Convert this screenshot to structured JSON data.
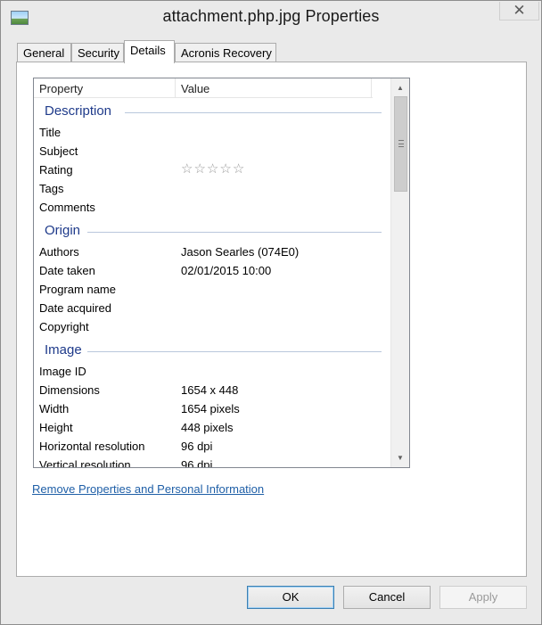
{
  "window": {
    "title": "attachment.php.jpg Properties",
    "close_glyph": "✕"
  },
  "tabs": [
    {
      "label": "General"
    },
    {
      "label": "Security"
    },
    {
      "label": "Details"
    },
    {
      "label": "Acronis Recovery"
    }
  ],
  "active_tab": "Details",
  "list": {
    "columns": {
      "property": "Property",
      "value": "Value"
    },
    "groups": {
      "description": {
        "label": "Description",
        "rows": [
          {
            "prop": "Title",
            "val": ""
          },
          {
            "prop": "Subject",
            "val": ""
          },
          {
            "prop": "Rating",
            "val": ""
          },
          {
            "prop": "Tags",
            "val": ""
          },
          {
            "prop": "Comments",
            "val": ""
          }
        ]
      },
      "origin": {
        "label": "Origin",
        "rows": [
          {
            "prop": "Authors",
            "val": "Jason Searles (074E0)"
          },
          {
            "prop": "Date taken",
            "val": "02/01/2015 10:00"
          },
          {
            "prop": "Program name",
            "val": ""
          },
          {
            "prop": "Date acquired",
            "val": ""
          },
          {
            "prop": "Copyright",
            "val": ""
          }
        ]
      },
      "image": {
        "label": "Image",
        "rows": [
          {
            "prop": "Image ID",
            "val": ""
          },
          {
            "prop": "Dimensions",
            "val": "1654 x 448"
          },
          {
            "prop": "Width",
            "val": "1654 pixels"
          },
          {
            "prop": "Height",
            "val": "448 pixels"
          },
          {
            "prop": "Horizontal resolution",
            "val": "96 dpi"
          },
          {
            "prop": "Vertical resolution",
            "val": "96 dpi"
          }
        ]
      }
    },
    "rating": {
      "stars_filled": 0,
      "stars_total": 5,
      "star_glyph": "☆"
    }
  },
  "remove_link": "Remove Properties and Personal Information",
  "buttons": {
    "ok": "OK",
    "cancel": "Cancel",
    "apply": "Apply"
  },
  "icons": {
    "app": "image-file-icon",
    "scroll_up": "▲",
    "scroll_down": "▼"
  }
}
